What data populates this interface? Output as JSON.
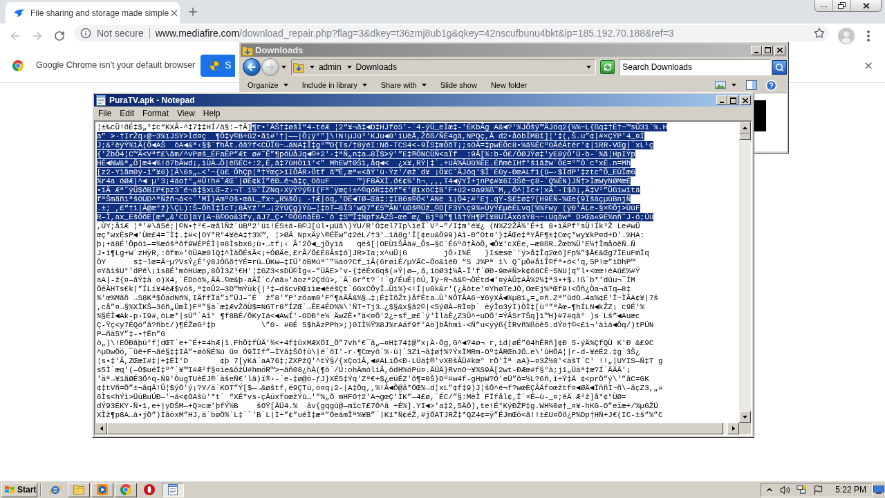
{
  "browser": {
    "tabs": [
      {
        "title": "File sharing and storage made simple",
        "selected": true
      }
    ],
    "nav_buttons": [
      {
        "kind": "back",
        "disabled": true
      },
      {
        "kind": "forward",
        "disabled": true
      },
      {
        "kind": "reload",
        "disabled": false
      }
    ],
    "address_bar": {
      "security": "Not secure",
      "host": "www.mediafire.com",
      "path": "/download_repair.php?flag=3&dkey=t36zmj8ub1g&qkey=42nscufbunu4bkt&ip=185.192.70.188&ref=3"
    },
    "infobar": {
      "message": "Google Chrome isn't your default browser",
      "button": "S"
    }
  },
  "explorer": {
    "title": "Downloads",
    "active": false,
    "breadcrumb": [
      "admin",
      "Downloads"
    ],
    "search": {
      "placeholder": "Search Downloads"
    },
    "commands": [
      {
        "label": "Organize",
        "dropdown": true
      },
      {
        "label": "Include in library",
        "dropdown": true
      },
      {
        "label": "Share with",
        "dropdown": true
      },
      {
        "label": "Slide show",
        "dropdown": false
      },
      {
        "label": "New folder",
        "dropdown": false
      }
    ]
  },
  "notepad": {
    "title": "PuraTV.apk - Notepad",
    "active": true,
    "menu": [
      "File",
      "Edit",
      "Format",
      "View",
      "Help"
    ],
    "lines": [
      [
        {
          "text": "¦±‰cÜ!ðÉ‡$„*‡c“KXÂ-^‡7‡‡HÍ/ä§:–†Â]",
          "selected": false
        },
        {
          "text": "¶r•'ÄŠ†‡øšÌ“4-téÆ ¦2“¥¬â‡◄D‡HJfoS'-`4-ýÛ_eÌæ‡-'ÉKbÃg A&◄?'%JÕšý™ÄJöq2{¼%~L{ßq‡†È†~™sÜ31`%.H",
          "selected": true
        }
      ],
      [
        {
          "text": "a” >·†IrŽq›@~3%ïJSY>Ìd¤ç  ¶Õ‡y©B+û2•âì#'†|——|Ô¡ÿ°”]\\!N!µJú³'KJu◄0'iUèÅ,Žõß/ÑÈ4gä,NPQç,Å d2•åòbÍMBî]¦'‡(,Š.u”¢|#×ÇÝP'4_¤Ì",
          "selected": true
        }
      ],
      [
        {
          "text": "J;&²èýÝ%ìÄ(Ö◄AŠ  òA◄&ª‹§$¨fhÅt.ðâ?f<CÜÏG~→äNA‡Î‡g°™O{Ts/†8ýéI:Nõ-TCS4<-9ÎS‡mÕõT¡;sOÄ=‡pwÉÕc8•%ä¼ÉCºOÅéÁtér'¢|1RR-VŒg|´xL¹ç",
          "selected": true
        }
      ],
      [
        {
          "text": "{'ŽbÕ4¦C™Ä<Vªf£\\âm/^vPøš_ÉFaÊP“Æt ø#˜Ê”¶póÙåJq◄©+2'·‡ªÑ„n‡a→8Ï$>ÿ'”E‡®ÖNCÜÑ<aÏf  :9Å[%:b-Õ£/ÖØJÝø‡'yE8ýÕ'Ù-b-`%â¦HpIÝp",
          "selected": true
        }
      ],
      [
        {
          "text": "HÉ◄NW&ª„Õ]æ4◄¼!ö7bÂwd¡,iÙÀ→Ö|ëßÉC+:2,É,ä‡7ùHÒïï‘<” MhEW†0Šì,åq◄<  ¿x¥,RÝ|‡`.+UÄ%ÂÚù%ÊE.ÉñmèIHf°š1âžw`Ö£=°”Ò`c*xÉ.n=Mh",
          "selected": true
        }
      ],
      [
        {
          "text": "[z2-Yìãm0ý-ì”¥6}¦Â\\6s„←<'~{ù£ ÕhÇp¦ª†Ýœç>ïIÕÂR›Ötf ã™Ê,æª«<âÝ'ù·Ýz'/øž`d¥ ¡Ö¥C˜ÄJöq'$Ï`ÉGy-ÐœALf1{ù—·$ÌdP'‡ztc”Ö_EÙÏæ6",
          "selected": true
        }
      ],
      [
        {
          "text": "%r4a óØÆ|^◄ µ'3¡4äo†°„#Ü!h#˜ÆŒ`|ØÉ¢kÍ”êÐ…ê¬â‡ç¸OòuF      ™)F8ÄXÌ.ð€¢¼'h¬¸,,,T4◄ýYÎ+jnP¢#¥6I3Šê~ç8-`Q%ÉN)JÑ†>ÌæWyNØMæÉ",
          "selected": true
        }
      ],
      [
        {
          "text": "•ïÄ Æª˜ÿÜ$ðBIP€pz3˜é¬ä‡§xLŒ–z›¬T 1½˜ÏZNq›XÿÝ?ý©I{Fª˜ÿœç!±^©qöR‡‡ôf”€'@ïxöC‡B'F+ú2•¤a9%ß˜M,,Ô^¦Ìc+¦xÂ`·I$ð¡‚Ä‡V²”ÜGiwïtä",
          "selected": true
        }
      ],
      [
        {
          "text": "fªŠmãñ1ªšOÙD^ªÑžñ¬á<÷ˆ'MÌ)AmºOš•œäL_fx÷„R%šÔ¡ ·†Æ|öq,'DÉ◄TØ–Œä‡:‡IB6s©Ö<'ANë ï¡Õ4;#'Ej.qÝ-$£‡ø‡?(H9ÉÑ-%Œe{9ÏšäçµùBnjÑ",
          "selected": true
        }
      ],
      [
        {
          "text": ".±; ,£“†ì|Â@æ°ž}\\ÇL):Š–ÕhÏ‡ÌcT;8ÄYž'“→¡2ÝÙÇg}Ýù—¦‡bT—8Ï3'wQ7”£5™ÄN'ùDš®Ûž_©D[F3Ý\\ç9%»ÙÿÝ£µèÉLvq[%%Fwy (ÿÐ'ÁLe-§×©Öj>ÙüF",
          "selected": true
        }
      ],
      [
        {
          "text": "R–Î,ax_EšÕõE[æª„&'CD]äY|A~B©Oo&3fy,áJ7_Ç•'©ÕGnâÊÐ-ˆô`‡S™Ï‡NpfxÄZŠ-œe¯œ¿¯Bjº0”¶lâ†ÝH¶PÌ¥8UÌÄxòsY8¬~‹Uqãwª D>Œa«9É%nñ˜J-ö;Üü",
          "selected": true
        }
      ],
      [
        {
          "text": ",ÙY;åïÆ ¦ª'#\\â5é;|©N•†²€–œâlÑž¨üBº2'üi!ÉS±ä-B©J[úl•µUâ\\)ÝU/R'Ó‡el7Ip\\ìeÏ`V²–”/I‡m'é¥¿ (N%Z2ŽÄ¾'É+ï 8•ïÄPf°sÜ!Ík³Ž Le#wÜ",
          "selected": false
        }
      ],
      [
        {
          "text": "œç*wxÈsP◄'Ùœ£4=˜Ì‡.‡#<|OY*R°4¥èA‡†3%™, ¦>ØÄ NpxÄÿ\\®ÉËw”¢2éL/†3'…1ä8g'Ï[¢eu&Õ99)Aì-Ð”Ot¤'}‡ÄŒe‡ªYÅF¶±‡Cœç*wy¥kP¤d+D'.%HA:",
          "selected": false
        }
      ],
      [
        {
          "text": "þ¡+ä8É'Öpö1—=¾æóšªôf9WÉPÈÌ|¤8Ìsbx6;ù•→tf¡‹ Â'2Ö◄_jÖyïä   qëš[|OEÙ1ŠÂä#_Ôs—§C¨É6ºð†ÄöÕ,◄Ô¥'cXÈe,—æ8ßR…Žœb%Ü'E¼†ÎmåòêÑ…Ñ",
          "selected": false
        }
      ],
      [
        {
          "text": "J•ì¶Lg+W`zHÿR,:ôfm»'OÜAæ0lQ‡^ÌàÖÉsÄ<¡+ÓØÄe,£rÂ/Õ£É8Âs‡ó]JR>Ia;x^uÜ|G        jÕ›I%É   }Isæsœ¨'ÿ>å‡Îq2œò]Fp%”$Å€&Œg7ÏEuFmÏq",
          "selected": false
        }
      ],
      [
        {
          "text": "ÒY      s‡~lœ=Ä~µ?VsÝ¿É'ý8JÒßõ†YÉ=rü←ÜKw—‡IÜ'òBMúª˜”¼äó?Cf_iÂ(6røiÉ/µYÄC–Õo&ìéÐ “S J%Pª ì\\ Q˜µÕ#åìÎ©fª•ó<'q,5P!œ”ìDhP™",
          "selected": false
        }
      ],
      [
        {
          "text": "¤YâìšU°'dPê\\¡ìs8É'mòHUæp,8ÕÌ3Z³€H'¦‡GZ3<sDÜ©Ìg«-”ÜÄE>'v-{‡éÉx6qš(»Ý|ø—,â,1öØ3‡¼Å-Ï'f`ØÐ-9œ#Ñ>k¢ó8CÈ~5NU¦q”l•<œœ!éAû£%#Ý",
          "selected": false
        }
      ],
      [
        {
          "text": "aA|-ž{¤–âÝ‡ä o)X4,¨ËDöò%,ÄÄ…©œ&þ·aÄÏ`c/øâ»'äozª2Çdû>,¨Ä`6r“t?¨!´g/ÉuÉ|òÚ,Ïÿ~R¬â&©¬ÖÉtd◄'¤ýÀÛ‡AÂ%2¼‡ª3•+$.!ß´b*'dûu¬¯ÍM",
          "selected": false
        }
      ],
      [
        {
          "text": "ÕêÄHTs€k|”ÍLï¥4èÆ$vóš,ª‡¤Û2—3D™mÝük{|²‡—dšcvÐŒïìæ◄ééšÇt`6GxCÖyÎ→Ü1%}<!Í|uGk&r'(¿Äòte'¤YhøTeJÕ,OœEj%ªŒf9!<Õñ¿Òa¬âTq—8‡",
          "selected": false
        }
      ],
      [
        {
          "text": "%'œ%Mâõ →S8Kª$ÖädNñ%,IÄffÏä”i”ÜJ–˜É  ž”8'”P'zôam0'F”¶äÄÂ&%§→‡¡É‡ÌõŽt)åfÉta→Ù'NÔTÂA6~¥6ýXÂ◄%µ81„=„¤ñ.Zª”ûdO→4a%¢É'Ï~ÌÂA¢¥|7š",
          "selected": false
        }
      ],
      [
        {
          "text": ",cå”¤→§%XÏKŠ—36ñ„ÜmÌ)Fª”§ä`æ‡ÆvŽðÙ$=NGTr8”ÍZŒ`→ÊE4ÉD%%\\'ÑT÷Tj3…¿$§&x§â2©|<5ýØÀ–RÏ¤þ` ëýÎo3ýÌ)ÒÌ‡[ù°”ªÄœ–¶hÍLN◄kŽZ¡ c9É'%",
          "selected": false
        }
      ],
      [
        {
          "text": "%§ÉÌ◄Ak-p›I9#,òLæ*|sÜ”`Aî° ¶f8BÉ/ÕKyIá<◄AwÍ'-ODÐ°e¼ ÄwZË•*ä<¤Ö'2¿÷sf_œ£`ÿ'ÌläÈ¿Z3Û^÷uDÕ'=ÝÄSrTŠq]1™H}#7#qâ° )s Lš”◄Auæc",
          "selected": false
        }
      ],
      [
        {
          "text": "Ç-Ÿç<y7ÉQö”â?ñbt/)¶ÉŽøG²‡þ          \\”0- #0É 5$hÄzPPh>;)0IÌ½Ÿ%8J%rAäf9f'Aö]bÅhmì·<Ñ”u<ÿýß{ÌRvñ%ßöê5.dÝö†©<£ì¬'äìá◄Ôq/)tPÜN",
          "selected": false
        }
      ],
      [
        {
          "text": "P—ñä5Y”‡-•†Ën”G",
          "selected": false
        }
      ],
      [
        {
          "text": "ò„)\\!EÕÐâþú°f¦dŒT´e+˜É+=4hÆ|î.FhÕ‡fÙÄ'¾<+4f‡ûxMÆXÖI_Ö”7vh°€¯â„—¤H‡74‡@”x¡À·Õg,G^◄?4ø¬ r,ìd|øÉ”04hÊRñ]¢Ð 5-ýÄ%ÇfQÜ K'Ð &£9C",
          "selected": false
        }
      ],
      [
        {
          "text": "^µDwÖö,¯ûê+F¬ãé§‡‡IÄ”÷øòÑÉ%ú û¤ Ó9ÏIf”—ÌYâ‡ŠÖ†ù\\|é`õI'-r·¶Cœyô`%·ù|`3Zì¬â‡ø†%?ÝxÏMRm-Oº‡ÄRŒnJÖ…e\\'ùHÕA¦|r-d-¥éÉ2.‡g`3Š¿",
          "selected": false
        }
      ],
      [
        {
          "text": "¦s•‡'Â,ZŒæI#‡|+‡ËÌ'D       ¢þ 7[yKá¨aA76‡;ZXPžQ'^tÝ§/{xÇo1Â,◄#ALiÖ<Ð·LÜä‡®'vXÐšÂÜ#kœ° rÖ'Ìª aA}—¤3Ž½0'<äšT`C' !!„|UYIS—Ñ‡T g",
          "selected": false
        }
      ],
      [
        {
          "text": "s5Ì`æq'(–Õ$uéÏ‡º”`¥™I#Æ²f§¤ïe&ôžÙ#hmöR™>¬âñ08¿hÀ(¶ò`/Ú:ohÄmólìÂ,ôdH%óPü¤.ÄÜÄ}RvnO~¥%S9Ä[2wt-ÐÆœ#f§°à;j1„Üäª‡æ?Í`ÄÄÄ'¡",
          "selected": false
        }
      ],
      [
        {
          "text": "'äª→¥1ãØÉ3Ö^q-Ñ9'ÒugTUèÉJ®´àšeÑ€'lâ)ï®›-´e-‡ø@ö-ƒJ}XÉ5‡Ýq'Zª€+$¿eüÉZ'õ¶=0Š}Dº#w4f-gHpW?Ó'eÜ”õ=½L?6ñ,ì÷Ý‡Ä ¢<prÖ”ý\\'”âC=GK",
          "selected": false
        }
      ],
      [
        {
          "text": "¢‡tVñ=Ö”±¬âqÄ!Û¦$ýÖ'ý¡?Y/ä`KOT”Ý[$—→&øštf,ë9ÇTü,ö¤q¡2-|A‡Öq,,%!Â◄Ô@â*ÖŒ%→d¦xL”¢f‡9)J¦šÕ^é¬f?wœÈÇÂÄfoœžtf¤◄ØÄ◄ÏññÌ~ñ\\–âçZ3,„»",
          "selected": false
        }
      ],
      [
        {
          "text": "6Ìs<hÝì>ÜüBuÚÐ—'¬á<¢ÕAšù'*t` “XÉ*vs-çÄüxfoœžÝù…'”%„Õ mHFO†2'A¬gœÇ'ÌK”—4£ø,¨ÉC/”§:MèÌ FÏfål¢,Ï`×É—ù-_¤;éÄ Æ²ž]å*¢°ÙØ=",
          "selected": false
        }
      ],
      [
        {
          "text": "dÝ93ÉKY-Ñ•1,e+|yDŠM—+Q>cœ'þfÝ½B    šOŸ[ÄÜ4.%  âv{gqgù@—mîcT£7Ó^â ÷É%].YI◄>'a‡2,5ÄÖ),te!É°KýÐŽP‡g.WH¼0ø†_¤¥-hKG-O”eïæ+/%µGŽÜ",
          "selected": false
        }
      ],
      [
        {
          "text": "XÌž¶p8A…à•jÕ”)ÌâöxM”HJ,ä`bøÖ%`L‡`ˆ'B`L|Ì÷”¢”uéÌ‡æª”ÕeámÎª%¥B”´|K1*Ñ¢éŽ,#jÕATJRŽ‡*QZ4¢=ÿ”ÉJmŒó<ã!!±£U¤Õð¿P%Dp†HÑ+J€(IC-±š”%”C",
          "selected": false
        }
      ]
    ]
  },
  "taskbar": {
    "start": "Start",
    "items": [
      {
        "kind": "e-logo",
        "running": false,
        "selected": false
      },
      {
        "kind": "folder",
        "running": true,
        "selected": false
      },
      {
        "kind": "media",
        "running": true,
        "selected": false
      },
      {
        "kind": "browser",
        "running": true,
        "selected": false
      },
      {
        "kind": "o-logo",
        "running": false,
        "selected": false
      },
      {
        "kind": "notepad",
        "running": true,
        "selected": true
      }
    ],
    "clock": "5:22 PM"
  }
}
